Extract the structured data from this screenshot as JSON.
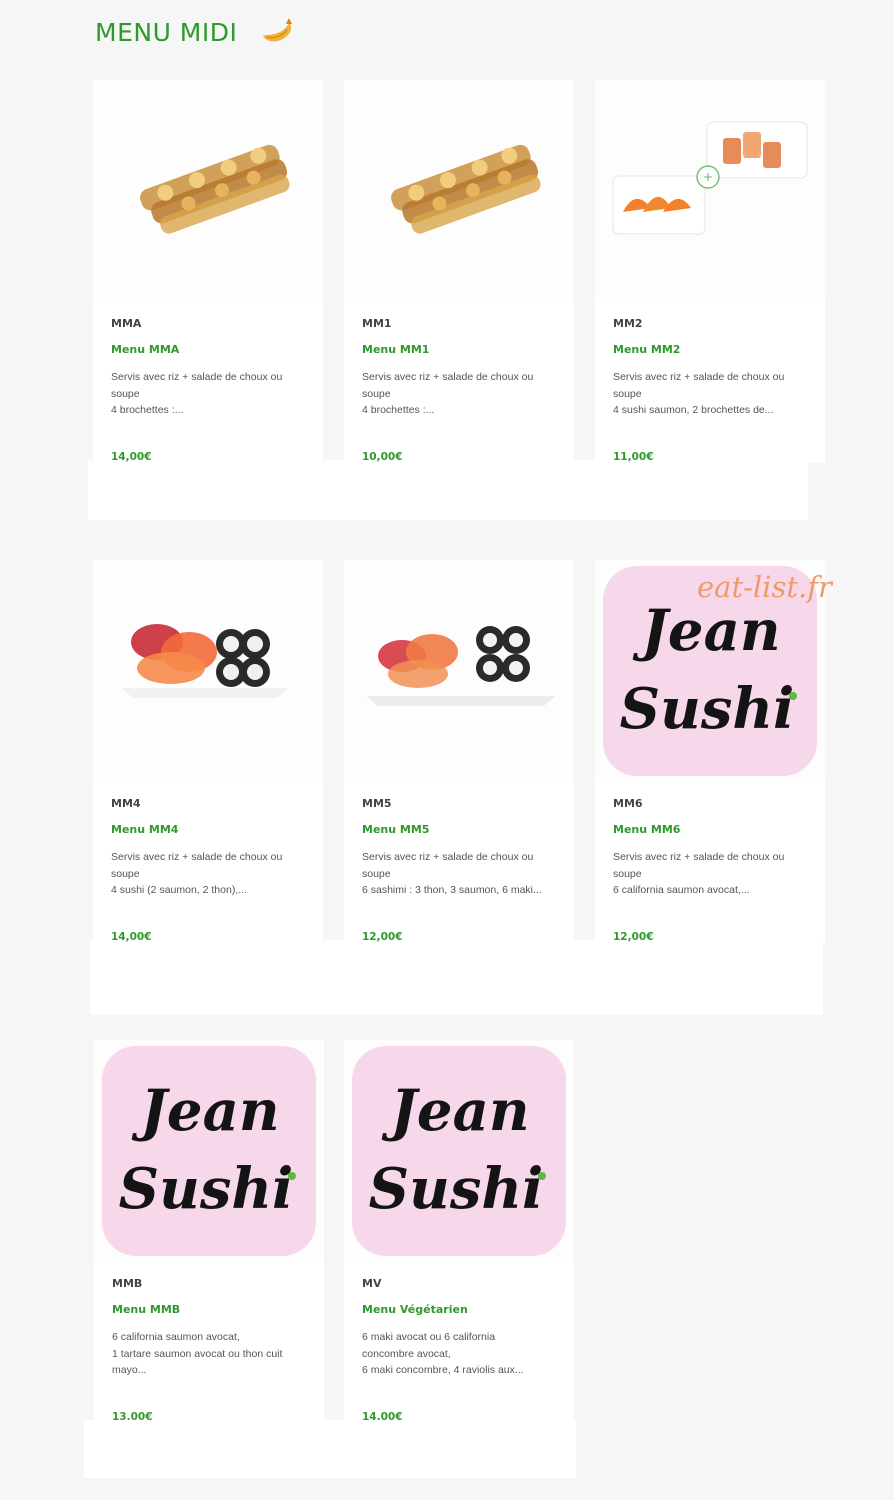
{
  "section": {
    "title": "MENU MIDI",
    "icon": "shrimp-tempura-icon"
  },
  "watermark": "eat-list.fr",
  "colors": {
    "accent": "#2e9a2b",
    "watermark": "#ef9a6c",
    "background": "#f6f6f6",
    "logo_pink": "#f7d7ea"
  },
  "items": [
    {
      "code": "MMA",
      "name": "Menu MMA",
      "desc": [
        "Servis avec riz + salade de choux ou",
        "soupe",
        "4 brochettes :..."
      ],
      "price": "14,00€",
      "image": "brochettes-photo"
    },
    {
      "code": "MM1",
      "name": "Menu MM1",
      "desc": [
        "Servis avec riz + salade de choux ou",
        "soupe",
        "4 brochettes :..."
      ],
      "price": "10,00€",
      "image": "brochettes-photo"
    },
    {
      "code": "MM2",
      "name": "Menu MM2",
      "desc": [
        "Servis avec riz + salade de choux ou",
        "soupe",
        "4 sushi saumon, 2 brochettes de..."
      ],
      "price": "11,00€",
      "image": "sushi-brochettes-photo"
    },
    {
      "code": "MM4",
      "name": "Menu MM4",
      "desc": [
        "Servis avec riz + salade de choux ou",
        "soupe",
        "4 sushi (2 saumon, 2 thon),..."
      ],
      "price": "14,00€",
      "image": "sushi-maki-platter-photo"
    },
    {
      "code": "MM5",
      "name": "Menu MM5",
      "desc": [
        "Servis avec riz + salade de choux ou",
        "soupe",
        "6 sashimi : 3 thon, 3 saumon, 6 maki..."
      ],
      "price": "12,00€",
      "image": "sashimi-maki-platter-photo"
    },
    {
      "code": "MM6",
      "name": "Menu MM6",
      "desc": [
        "Servis avec riz + salade de choux ou",
        "soupe",
        "6 california saumon avocat,..."
      ],
      "price": "12,00€",
      "image": "jean-sushi-logo"
    },
    {
      "code": "MMB",
      "name": "Menu MMB",
      "desc": [
        "6 california saumon avocat,",
        "1 tartare saumon avocat ou thon cuit",
        "mayo..."
      ],
      "price": "13.00€",
      "image": "jean-sushi-logo"
    },
    {
      "code": "MV",
      "name": "Menu Végétarien",
      "desc": [
        "6 maki avocat ou 6 california",
        "concombre avocat,",
        "6 maki concombre, 4 raviolis aux..."
      ],
      "price": "14.00€",
      "image": "jean-sushi-logo"
    }
  ],
  "logo_text": [
    "Jean",
    "Sushi"
  ]
}
